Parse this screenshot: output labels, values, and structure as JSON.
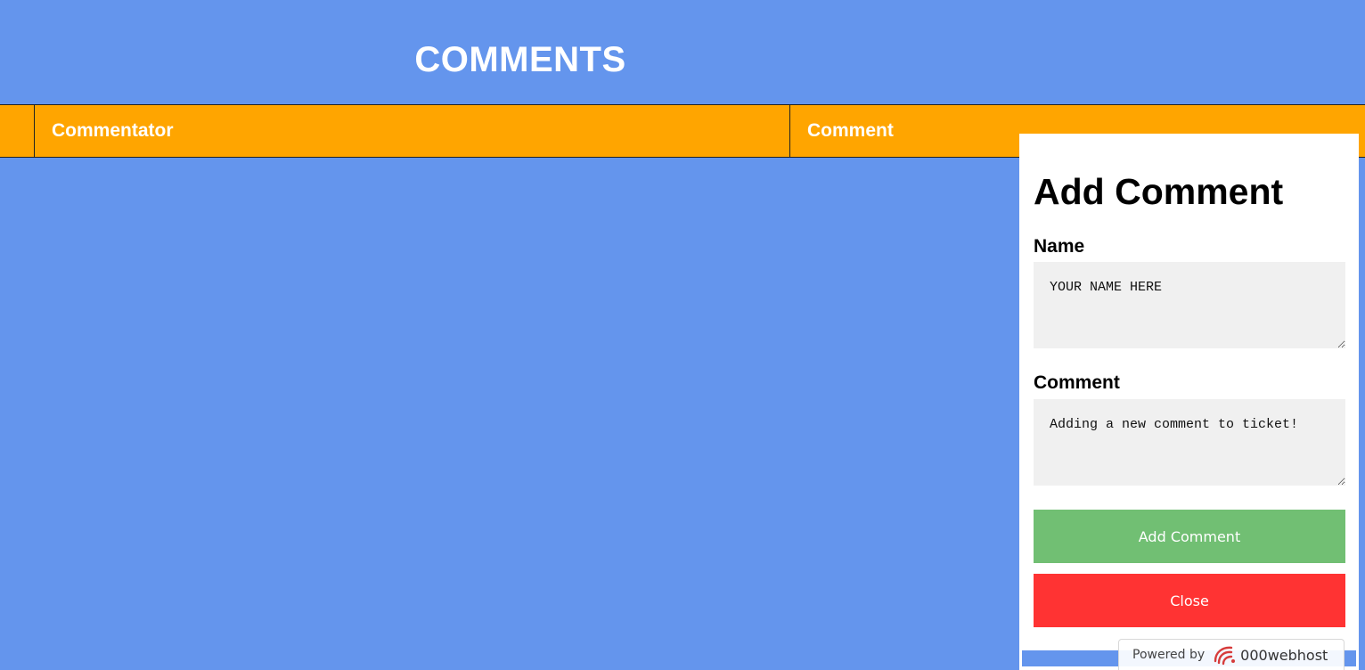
{
  "page": {
    "title": "COMMENTS"
  },
  "table": {
    "columns": [
      "",
      "Commentator",
      "Comment"
    ]
  },
  "modal": {
    "title": "Add Comment",
    "name_label": "Name",
    "name_value": "YOUR NAME HERE",
    "comment_label": "Comment",
    "comment_value": "Adding a new comment to ticket!",
    "add_button": "Add Comment",
    "close_button": "Close"
  },
  "footer_badge": {
    "prefix": "Powered by",
    "brand": "000webhost",
    "icon": "000webhost-logo-icon"
  },
  "colors": {
    "background": "#6495ED",
    "header_row": "#FFA500",
    "add_button": "#71BF73",
    "close_button": "#FF3333"
  }
}
